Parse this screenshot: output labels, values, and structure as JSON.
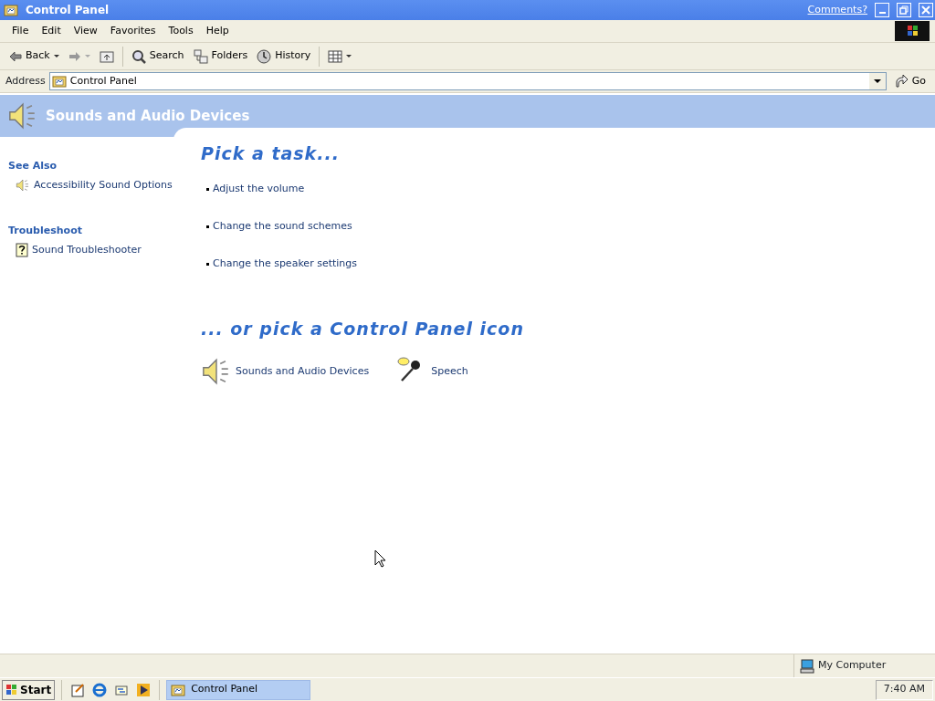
{
  "window": {
    "title": "Control Panel",
    "comments_link": "Comments?"
  },
  "menu": [
    "File",
    "Edit",
    "View",
    "Favorites",
    "Tools",
    "Help"
  ],
  "toolbar": [
    {
      "kind": "back",
      "label": "Back"
    },
    {
      "kind": "forward"
    },
    {
      "kind": "up"
    },
    {
      "kind": "search",
      "label": "Search"
    },
    {
      "kind": "folders",
      "label": "Folders"
    },
    {
      "kind": "history",
      "label": "History"
    },
    {
      "kind": "views"
    }
  ],
  "address": {
    "label": "Address",
    "value": "Control Panel",
    "go": "Go"
  },
  "category": {
    "title": "Sounds and Audio Devices"
  },
  "sidebar": [
    {
      "heading": "See Also",
      "items": [
        {
          "kind": "speaker",
          "label": "Accessibility Sound Options"
        }
      ]
    },
    {
      "heading": "Troubleshoot",
      "items": [
        {
          "kind": "help",
          "label": "Sound Troubleshooter"
        }
      ]
    }
  ],
  "tasks": {
    "heading": "Pick a task...",
    "items": [
      "Adjust the volume",
      "Change the sound schemes",
      "Change the speaker settings"
    ]
  },
  "icons": {
    "heading": "... or pick a Control Panel icon",
    "items": [
      {
        "kind": "speaker",
        "label": "Sounds and Audio Devices"
      },
      {
        "kind": "microphone",
        "label": "Speech"
      }
    ]
  },
  "status_bar": {
    "zone": "My Computer"
  },
  "taskbar": {
    "start": "Start",
    "quick_launch": [
      {
        "kind": "notepad"
      },
      {
        "kind": "browser"
      },
      {
        "kind": "sync"
      },
      {
        "kind": "media"
      }
    ],
    "tasks": [
      {
        "label": "Control Panel",
        "selected": true
      }
    ],
    "clock": "7:40 AM"
  }
}
